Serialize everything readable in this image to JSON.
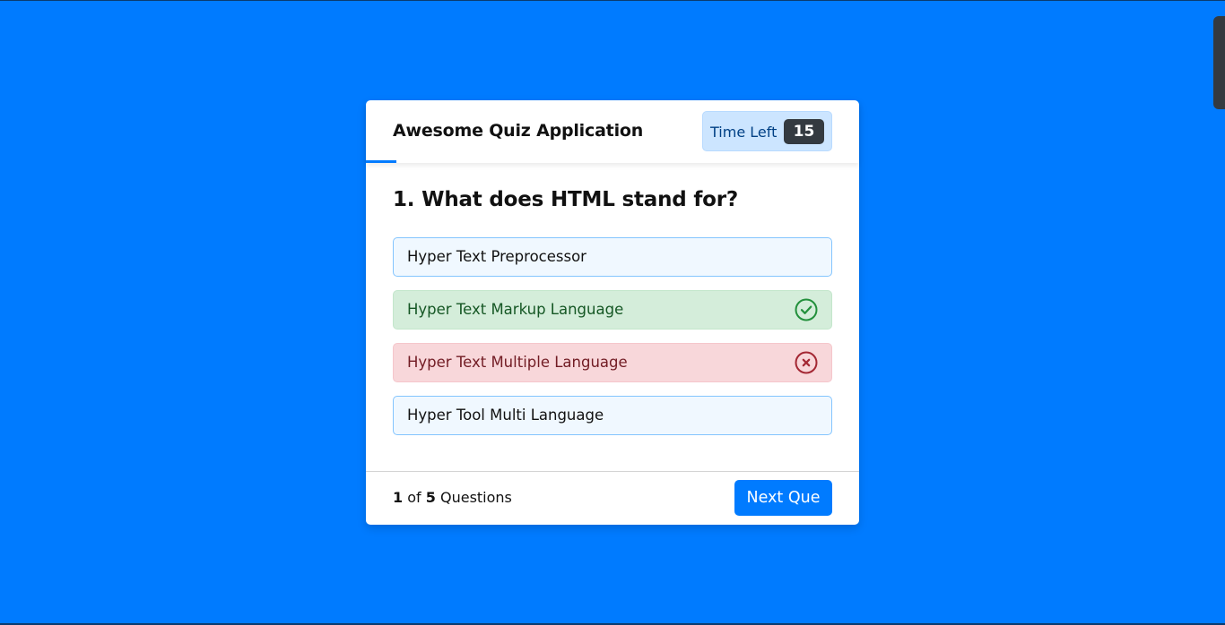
{
  "quiz": {
    "title": "Awesome Quiz Application",
    "timer_label": "Time Left",
    "timer_seconds": "15",
    "question": "1. What does HTML stand for?",
    "options": [
      {
        "label": "Hyper Text Preprocessor",
        "state": "default"
      },
      {
        "label": "Hyper Text Markup Language",
        "state": "correct",
        "icon": "check-circle-icon"
      },
      {
        "label": "Hyper Text Multiple Language",
        "state": "incorrect",
        "icon": "x-circle-icon"
      },
      {
        "label": "Hyper Tool Multi Language",
        "state": "default"
      }
    ],
    "footer": {
      "current": "1",
      "of_text": "of",
      "total": "5",
      "questions_text": "Questions",
      "next_label": "Next Que"
    }
  },
  "colors": {
    "background": "#007bff",
    "correct_bg": "#d4edda",
    "incorrect_bg": "#f8d7da",
    "option_bg": "#f0f8ff"
  }
}
